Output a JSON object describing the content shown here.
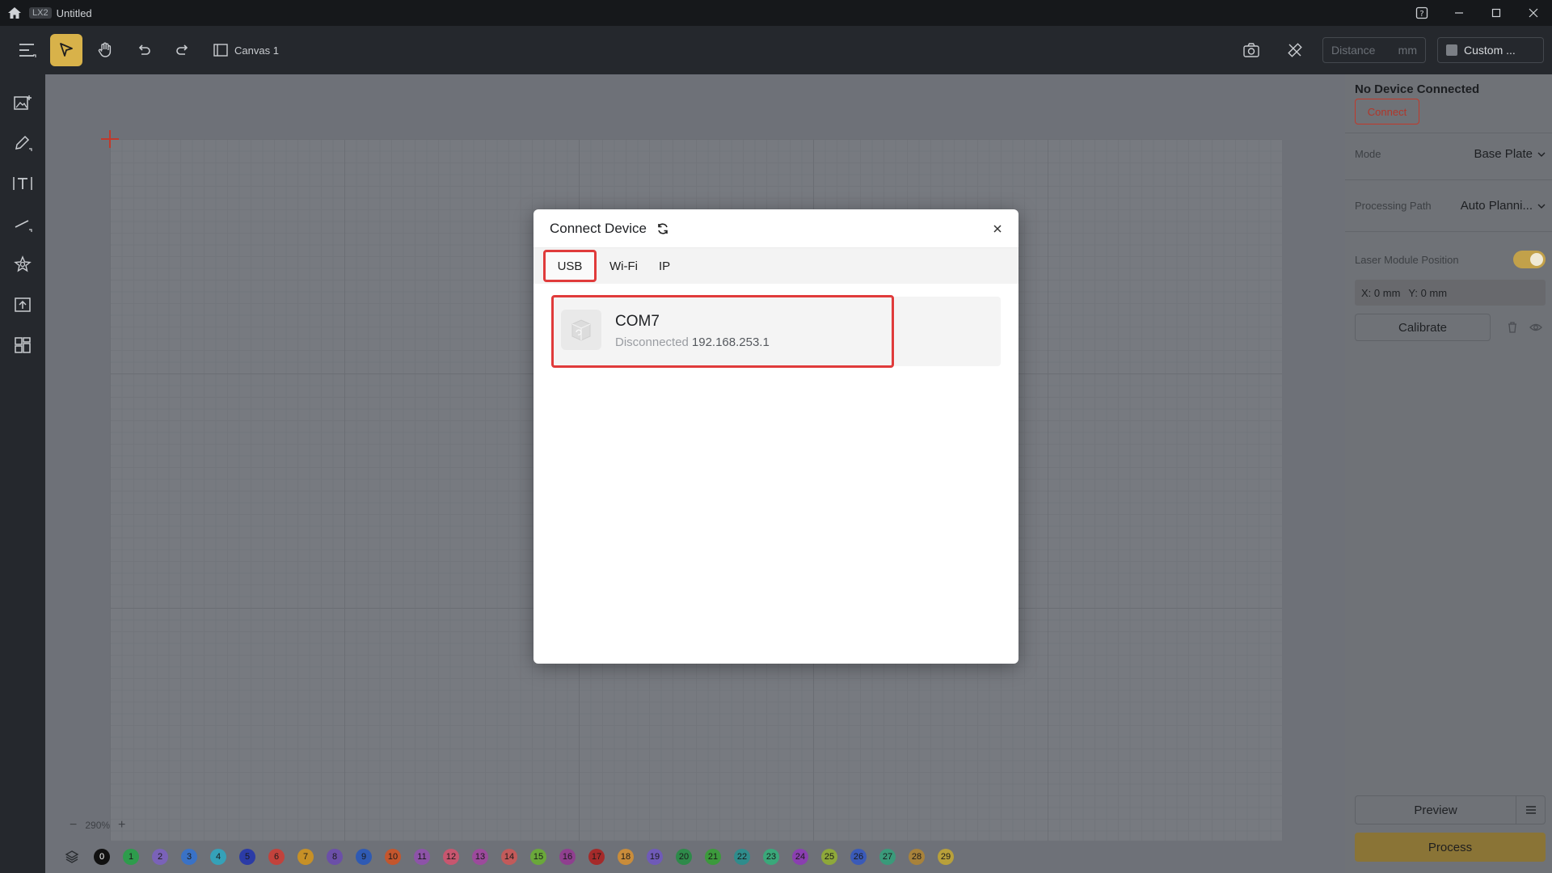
{
  "titlebar": {
    "app_badge": "LX2",
    "title": "Untitled"
  },
  "toolbar": {
    "canvas_label": "Canvas 1",
    "distance_placeholder": "Distance",
    "distance_unit": "mm",
    "custom_label": "Custom ..."
  },
  "canvas": {
    "zoom": "290%"
  },
  "colorbar": {
    "layers": [
      {
        "num": "0",
        "color": "#111111",
        "text": "#ffffff"
      },
      {
        "num": "1",
        "color": "#2e9c4c",
        "text": "#1a1a1a"
      },
      {
        "num": "2",
        "color": "#7a62b8",
        "text": "#1a1a1a"
      },
      {
        "num": "3",
        "color": "#3a72c6",
        "text": "#1a1a1a"
      },
      {
        "num": "4",
        "color": "#35a1b8",
        "text": "#1a1a1a"
      },
      {
        "num": "5",
        "color": "#2b3ba6",
        "text": "#1a1a1a"
      },
      {
        "num": "6",
        "color": "#c2423c",
        "text": "#1a1a1a"
      },
      {
        "num": "7",
        "color": "#c79026",
        "text": "#1a1a1a"
      },
      {
        "num": "8",
        "color": "#6b4fa8",
        "text": "#1a1a1a"
      },
      {
        "num": "9",
        "color": "#2f5ab3",
        "text": "#1a1a1a"
      },
      {
        "num": "10",
        "color": "#c4562d",
        "text": "#1a1a1a"
      },
      {
        "num": "11",
        "color": "#8d53a8",
        "text": "#1a1a1a"
      },
      {
        "num": "12",
        "color": "#c7566f",
        "text": "#1a1a1a"
      },
      {
        "num": "13",
        "color": "#9c4a9c",
        "text": "#1a1a1a"
      },
      {
        "num": "14",
        "color": "#c25a5a",
        "text": "#1a1a1a"
      },
      {
        "num": "15",
        "color": "#6aa83a",
        "text": "#1a1a1a"
      },
      {
        "num": "16",
        "color": "#8f3f8f",
        "text": "#1a1a1a"
      },
      {
        "num": "17",
        "color": "#a52a2a",
        "text": "#1a1a1a"
      },
      {
        "num": "18",
        "color": "#c98c3a",
        "text": "#1a1a1a"
      },
      {
        "num": "19",
        "color": "#6f5ab8",
        "text": "#1a1a1a"
      },
      {
        "num": "20",
        "color": "#2e8a4a",
        "text": "#1a1a1a"
      },
      {
        "num": "21",
        "color": "#3c9a3c",
        "text": "#1a1a1a"
      },
      {
        "num": "22",
        "color": "#2f8c8c",
        "text": "#1a1a1a"
      },
      {
        "num": "23",
        "color": "#3aa87a",
        "text": "#1a1a1a"
      },
      {
        "num": "24",
        "color": "#8a3fb0",
        "text": "#1a1a1a"
      },
      {
        "num": "25",
        "color": "#8ea83a",
        "text": "#1a1a1a"
      },
      {
        "num": "26",
        "color": "#3a5ab8",
        "text": "#1a1a1a"
      },
      {
        "num": "27",
        "color": "#3a9a7a",
        "text": "#1a1a1a"
      },
      {
        "num": "28",
        "color": "#a8823a",
        "text": "#1a1a1a"
      },
      {
        "num": "29",
        "color": "#b8a03a",
        "text": "#1a1a1a"
      }
    ]
  },
  "rightpanel": {
    "status_title": "No Device Connected",
    "connect_label": "Connect",
    "mode_label": "Mode",
    "mode_value": "Base Plate",
    "path_label": "Processing Path",
    "path_value": "Auto Planni...",
    "laser_label": "Laser Module Position",
    "x_coord": "X: 0 mm",
    "y_coord": "Y: 0 mm",
    "calibrate_label": "Calibrate",
    "preview_label": "Preview",
    "process_label": "Process"
  },
  "modal": {
    "title": "Connect Device",
    "tabs": [
      "USB",
      "Wi-Fi",
      "IP"
    ],
    "device": {
      "name": "COM7",
      "status": "Disconnected",
      "ip": "192.168.253.1"
    }
  },
  "colors": {
    "accent": "#d8b24a",
    "highlight": "#e03b3b"
  }
}
